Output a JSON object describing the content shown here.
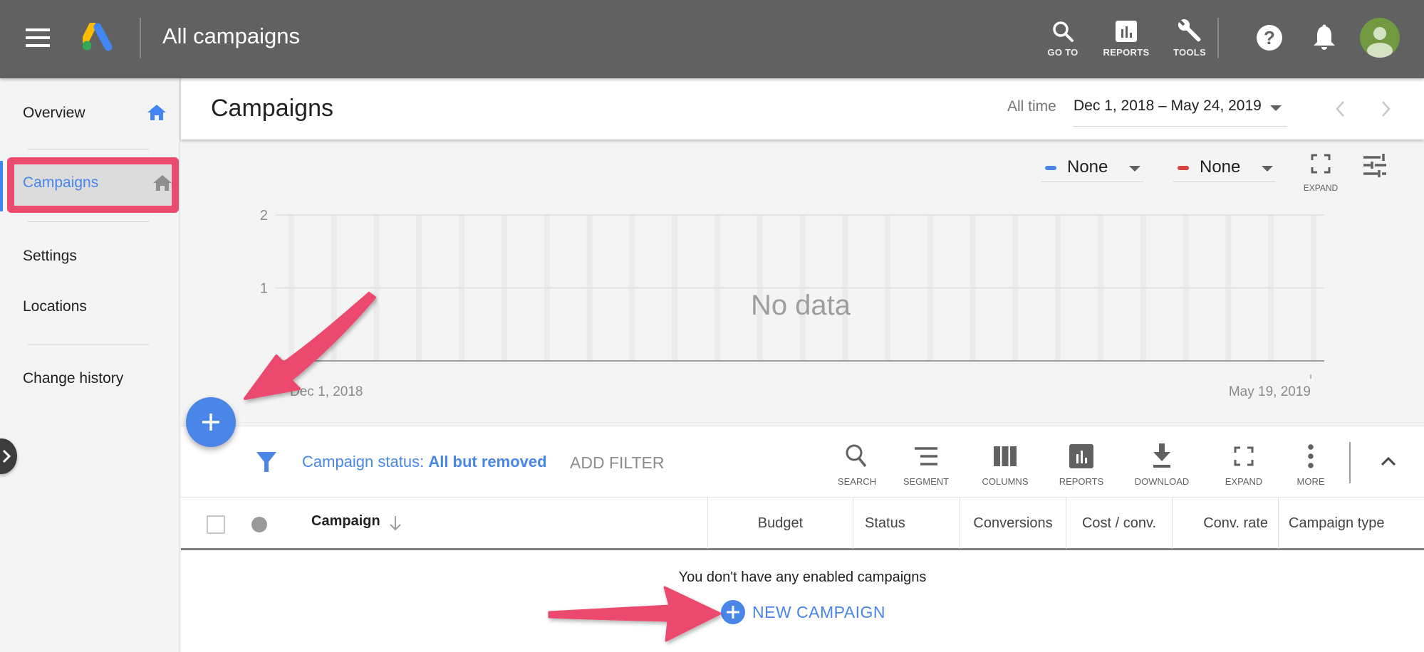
{
  "topbar": {
    "title": "All campaigns",
    "actions": [
      {
        "label": "GO TO",
        "icon": "search-icon"
      },
      {
        "label": "REPORTS",
        "icon": "reports-icon"
      },
      {
        "label": "TOOLS",
        "icon": "wrench-icon"
      }
    ],
    "icons": [
      "help-icon",
      "notifications-bell-icon",
      "account-avatar"
    ]
  },
  "sidebar": {
    "items": [
      {
        "label": "Overview",
        "active": false,
        "home_icon": true
      },
      {
        "label": "Campaigns",
        "active": true,
        "home_icon": true
      },
      {
        "label": "Settings",
        "active": false
      },
      {
        "label": "Locations",
        "active": false
      },
      {
        "label": "Change history",
        "active": false
      }
    ]
  },
  "header": {
    "title": "Campaigns",
    "date_label": "All time",
    "date_range": "Dec 1, 2018 – May 24, 2019"
  },
  "chart_controls": {
    "metric1": {
      "label": "None",
      "color": "#4a86e8"
    },
    "metric2": {
      "label": "None",
      "color": "#d9453d"
    },
    "expand_label": "EXPAND"
  },
  "chart_data": {
    "type": "line",
    "title": "",
    "xlabel": "",
    "ylabel": "",
    "series": [],
    "x_tick_labels": [
      "Dec 1, 2018",
      "May 19, 2019"
    ],
    "y_ticks": [
      0,
      1,
      2
    ],
    "y_tick_labels": [
      "1",
      "2"
    ],
    "ylim": [
      0,
      2
    ],
    "xlim": [
      "Dec 1, 2018",
      "May 24, 2019"
    ],
    "grid": true,
    "empty_message": "No data"
  },
  "toolbar": {
    "filter_prefix": "Campaign status: ",
    "filter_value": "All but removed",
    "add_filter": "ADD FILTER",
    "buttons": [
      {
        "label": "SEARCH",
        "icon": "search-icon"
      },
      {
        "label": "SEGMENT",
        "icon": "segment-icon"
      },
      {
        "label": "COLUMNS",
        "icon": "columns-icon"
      },
      {
        "label": "REPORTS",
        "icon": "reports-icon"
      },
      {
        "label": "DOWNLOAD",
        "icon": "download-icon"
      },
      {
        "label": "EXPAND",
        "icon": "expand-icon"
      },
      {
        "label": "MORE",
        "icon": "more-vert-icon"
      }
    ]
  },
  "table": {
    "columns": [
      "Campaign",
      "Budget",
      "Status",
      "Conversions",
      "Cost / conv.",
      "Conv. rate",
      "Campaign type"
    ],
    "rows": [],
    "empty_message": "You don't have any enabled campaigns",
    "new_campaign_label": "NEW CAMPAIGN"
  },
  "colors": {
    "accent": "#4a86e8",
    "annotation": "#ec4a6e",
    "topbar": "#616161"
  }
}
